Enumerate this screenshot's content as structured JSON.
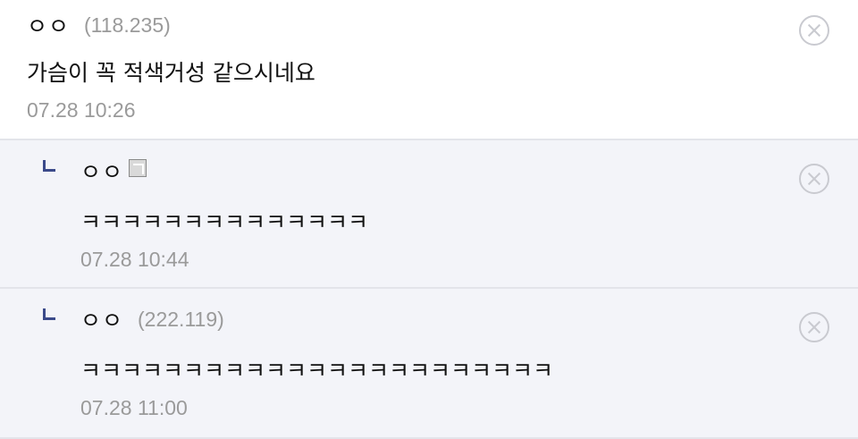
{
  "comments": [
    {
      "nick": "ㅇㅇ",
      "ip": "(118.235)",
      "text": "가슴이 꼭 적색거성 같으시네요",
      "date": "07.28 10:26"
    },
    {
      "nick": "ㅇㅇ",
      "text": "ㅋㅋㅋㅋㅋㅋㅋㅋㅋㅋㅋㅋㅋㅋ",
      "date": "07.28 10:44",
      "fixed_nick_icon": "fixed-nick-icon"
    },
    {
      "nick": "ㅇㅇ",
      "ip": "(222.119)",
      "text": "ㅋㅋㅋㅋㅋㅋㅋㅋㅋㅋㅋㅋㅋㅋㅋㅋㅋㅋㅋㅋㅋㅋㅋ",
      "date": "07.28 11:00"
    }
  ],
  "icons": {
    "delete": "close-circle-icon",
    "reply": "reply-arrow-icon"
  },
  "colors": {
    "reply_background": "#f3f4f9",
    "divider": "#e3e4ea",
    "meta_text": "#9a9a9a",
    "reply_mark": "#3b4a8a"
  }
}
